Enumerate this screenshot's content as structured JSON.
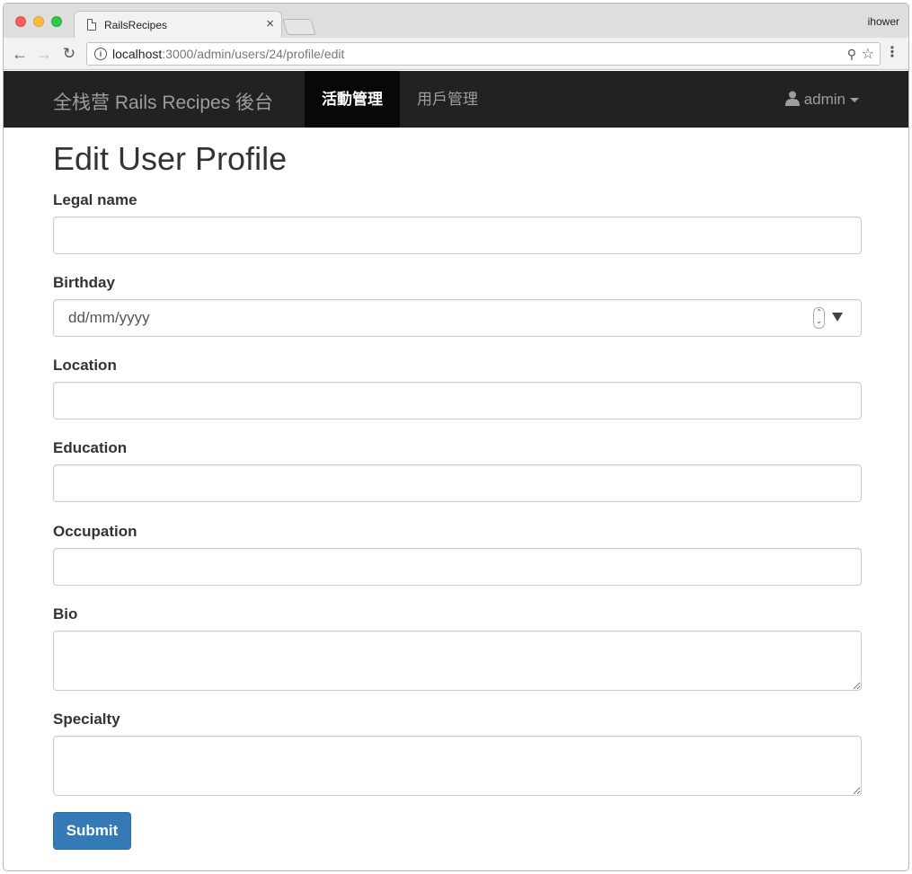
{
  "browser": {
    "tab_title": "RailsRecipes",
    "tab_close": "×",
    "profile_name": "ihower",
    "url_host": "localhost",
    "url_path": ":3000/admin/users/24/profile/edit"
  },
  "navbar": {
    "brand": "全栈营 Rails Recipes 後台",
    "items": [
      {
        "label": "活動管理",
        "active": true
      },
      {
        "label": "用戶管理",
        "active": false
      }
    ],
    "user_label": "admin"
  },
  "page": {
    "title": "Edit User Profile"
  },
  "form": {
    "fields": [
      {
        "label": "Legal name",
        "value": ""
      },
      {
        "label": "Birthday",
        "value": "dd/mm/yyyy"
      },
      {
        "label": "Location",
        "value": ""
      },
      {
        "label": "Education",
        "value": ""
      },
      {
        "label": "Occupation",
        "value": ""
      },
      {
        "label": "Bio",
        "value": ""
      },
      {
        "label": "Specialty",
        "value": ""
      }
    ],
    "submit_label": "Submit"
  },
  "icons": {
    "back": "arrow-left-icon",
    "forward": "arrow-right-icon",
    "reload": "reload-icon",
    "site_info": "info-icon",
    "zoom": "zoom-icon",
    "bookmark": "star-icon",
    "menu": "kebab-menu-icon",
    "user": "user-icon",
    "date_spinner": "spinner-icon",
    "date_dropdown": "dropdown-triangle-icon"
  },
  "colors": {
    "navbar_bg": "#222222",
    "navbar_active_bg": "#080808",
    "primary_button": "#337ab7"
  }
}
